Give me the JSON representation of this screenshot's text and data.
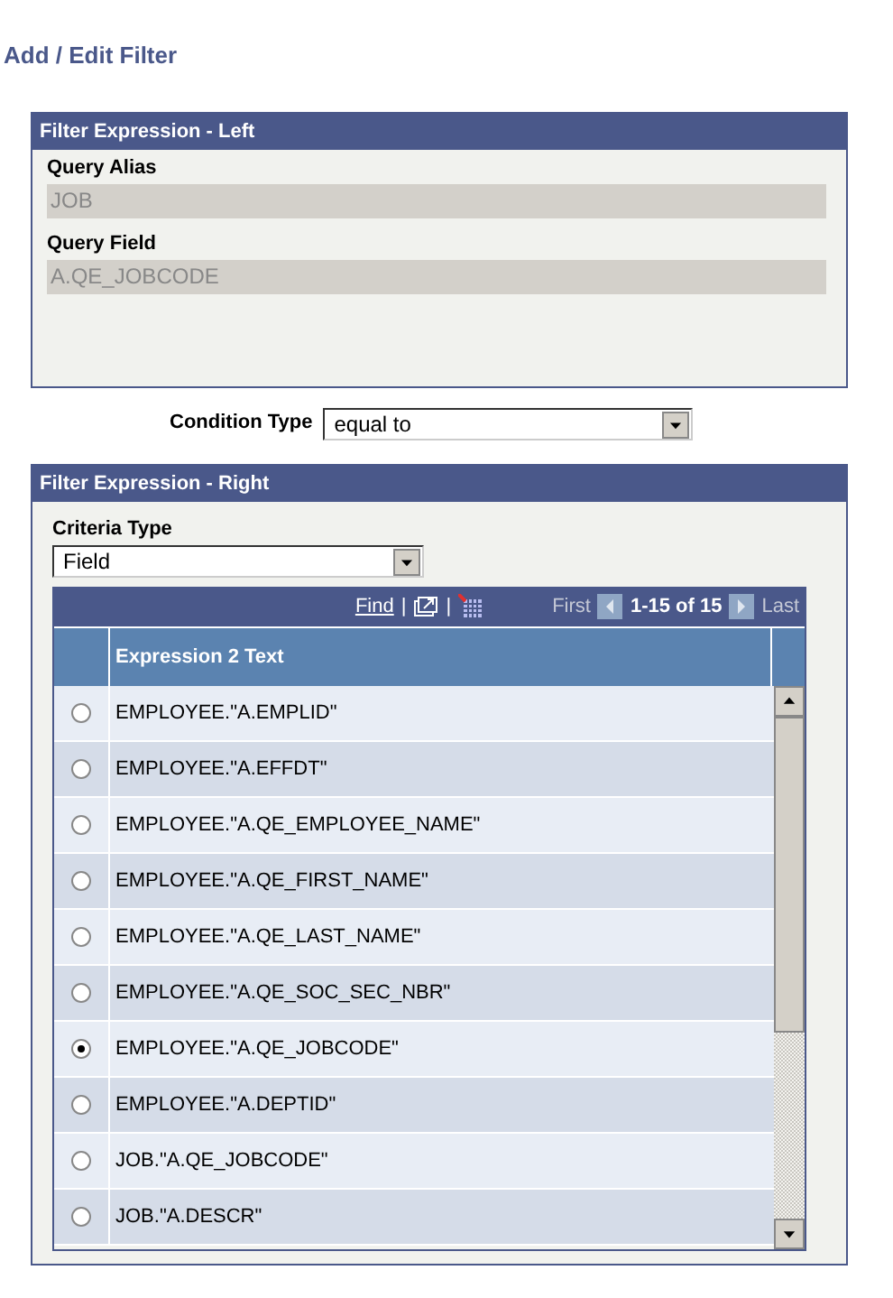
{
  "page_title": "Add / Edit Filter",
  "left_panel": {
    "title": "Filter Expression - Left",
    "fields": [
      {
        "label": "Query Alias",
        "value": "JOB",
        "disabled": true
      },
      {
        "label": "Query Field",
        "value": "A.QE_JOBCODE",
        "disabled": true
      }
    ]
  },
  "condition_type": {
    "label": "Condition Type",
    "value": "equal to"
  },
  "right_panel": {
    "title": "Filter Expression - Right",
    "criteria_type": {
      "label": "Criteria Type",
      "value": "Field"
    },
    "grid": {
      "find": "Find",
      "separator_1": "|",
      "separator_2": "|",
      "first": "First",
      "range": "1-15 of 15",
      "last": "Last",
      "column": "Expression 2 Text",
      "rows": [
        {
          "text": "EMPLOYEE.\"A.EMPLID\"",
          "selected": false
        },
        {
          "text": "EMPLOYEE.\"A.EFFDT\"",
          "selected": false
        },
        {
          "text": "EMPLOYEE.\"A.QE_EMPLOYEE_NAME\"",
          "selected": false
        },
        {
          "text": "EMPLOYEE.\"A.QE_FIRST_NAME\"",
          "selected": false
        },
        {
          "text": "EMPLOYEE.\"A.QE_LAST_NAME\"",
          "selected": false
        },
        {
          "text": "EMPLOYEE.\"A.QE_SOC_SEC_NBR\"",
          "selected": false
        },
        {
          "text": "EMPLOYEE.\"A.QE_JOBCODE\"",
          "selected": true
        },
        {
          "text": "EMPLOYEE.\"A.DEPTID\"",
          "selected": false
        },
        {
          "text": "JOB.\"A.QE_JOBCODE\"",
          "selected": false
        },
        {
          "text": "JOB.\"A.DESCR\"",
          "selected": false
        }
      ]
    }
  }
}
